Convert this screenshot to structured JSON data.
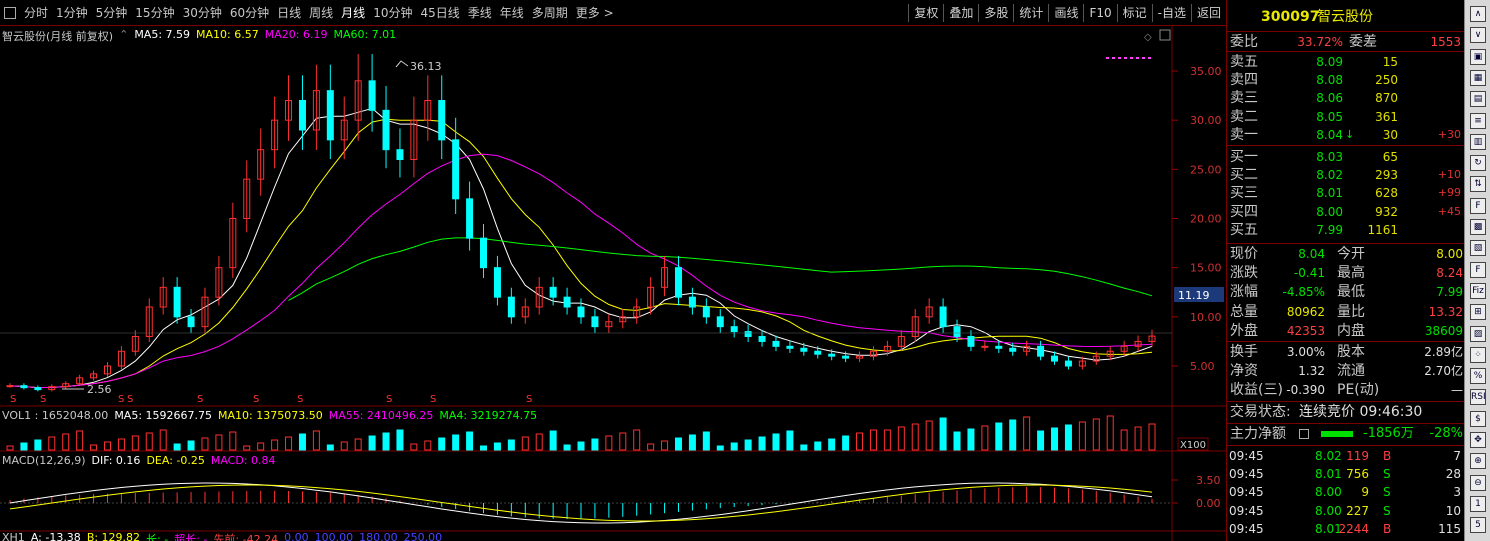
{
  "toolbar": {
    "periods": [
      "分时",
      "1分钟",
      "5分钟",
      "15分钟",
      "30分钟",
      "60分钟",
      "日线",
      "周线",
      "月线",
      "10分钟",
      "45日线",
      "季线",
      "年线",
      "多周期",
      "更多 >"
    ],
    "active_period": "月线",
    "tools": [
      "复权",
      "叠加",
      "多股",
      "统计",
      "画线",
      "F10",
      "标记",
      "-自选",
      "返回"
    ]
  },
  "main_legend": {
    "title": "智云股份(月线 前复权)",
    "ma5": "MA5: 7.59",
    "ma10": "MA10: 6.57",
    "ma20": "MA20: 6.19",
    "ma60": "MA60: 7.01",
    "high_label": "36.13",
    "low_label": "2.56",
    "last_price_tag": "11.19",
    "price_ticks": [
      "35.00",
      "30.00",
      "25.00",
      "20.00",
      "15.00",
      "10.00",
      "5.00"
    ],
    "marker_glyph": "S"
  },
  "vol_legend": {
    "vol": "VOL1 : 1652048.00",
    "ma5": "MA5: 1592667.75",
    "ma10": "MA10: 1375073.50",
    "ma55": "MA55: 2410496.25",
    "ma4": "MA4: 3219274.75",
    "unit": "X100"
  },
  "macd_legend": {
    "name": "MACD(12,26,9)",
    "dif": "DIF: 0.16",
    "dea": "DEA: -0.25",
    "macd": "MACD: 0.84",
    "ticks": [
      "3.50",
      "0.00"
    ]
  },
  "xh_legend": {
    "name": "XH1",
    "a": "A: -13.38",
    "b": "B: 129.82",
    "c": "长: -",
    "d": "超长: -",
    "e": "先前: -42.24",
    "f": "0.00",
    "g": "100.00",
    "h": "180.00",
    "i": "250.00"
  },
  "quote": {
    "code": "300097",
    "name": "智云股份",
    "weibi_label": "委比",
    "weibi": "33.72%",
    "weicha_label": "委差",
    "weicha": "1553",
    "asks": [
      {
        "label": "卖五",
        "price": "8.09",
        "vol": "15",
        "chg": ""
      },
      {
        "label": "卖四",
        "price": "8.08",
        "vol": "250",
        "chg": ""
      },
      {
        "label": "卖三",
        "price": "8.06",
        "vol": "870",
        "chg": ""
      },
      {
        "label": "卖二",
        "price": "8.05",
        "vol": "361",
        "chg": ""
      },
      {
        "label": "卖一",
        "price": "8.04",
        "vol": "30",
        "chg": "+30"
      }
    ],
    "bids": [
      {
        "label": "买一",
        "price": "8.03",
        "vol": "65",
        "chg": ""
      },
      {
        "label": "买二",
        "price": "8.02",
        "vol": "293",
        "chg": "+10"
      },
      {
        "label": "买三",
        "price": "8.01",
        "vol": "628",
        "chg": "+99"
      },
      {
        "label": "买四",
        "price": "8.00",
        "vol": "932",
        "chg": "+45"
      },
      {
        "label": "买五",
        "price": "7.99",
        "vol": "1161",
        "chg": ""
      }
    ],
    "stats": [
      {
        "l1": "现价",
        "v1": "8.04",
        "l2": "今开",
        "v2": "8.00"
      },
      {
        "l1": "涨跌",
        "v1": "-0.41",
        "l2": "最高",
        "v2": "8.24"
      },
      {
        "l1": "涨幅",
        "v1": "-4.85%",
        "l2": "最低",
        "v2": "7.99"
      },
      {
        "l1": "总量",
        "v1": "80962",
        "l2": "量比",
        "v2": "13.32"
      },
      {
        "l1": "外盘",
        "v1": "42353",
        "l2": "内盘",
        "v2": "38609"
      }
    ],
    "stats2": [
      {
        "l1": "换手",
        "v1": "3.00%",
        "l2": "股本",
        "v2": "2.89亿"
      },
      {
        "l1": "净资",
        "v1": "1.32",
        "l2": "流通",
        "v2": "2.70亿"
      },
      {
        "l1": "收益(三)",
        "v1": "-0.390",
        "l2": "PE(动)",
        "v2": "—"
      }
    ],
    "status_label": "交易状态:",
    "status": "连续竞价 09:46:30",
    "main_net_label": "主力净额",
    "main_net": "-1856万",
    "main_net_pct": "-28%",
    "ticks": [
      {
        "t": "09:45",
        "p": "8.02",
        "v": "119",
        "d": "B",
        "n": "7"
      },
      {
        "t": "09:45",
        "p": "8.01",
        "v": "756",
        "d": "S",
        "n": "28"
      },
      {
        "t": "09:45",
        "p": "8.00",
        "v": "9",
        "d": "S",
        "n": "3"
      },
      {
        "t": "09:45",
        "p": "8.00",
        "v": "227",
        "d": "S",
        "n": "10"
      },
      {
        "t": "09:45",
        "p": "8.01",
        "v": "2244",
        "d": "B",
        "n": "115"
      }
    ]
  },
  "side_icons": [
    "collapse-icon",
    "expand-icon",
    "down-icon",
    "grid-icon",
    "table-icon",
    "list-icon",
    "bar-chart-icon",
    "refresh-icon",
    "candle-icon",
    "fund-icon",
    "sector-icon",
    "news-icon",
    "ftab-icon",
    "fiz-icon",
    "hist-icon",
    "chart-icon",
    "scatter-icon",
    "pct-icon",
    "rsi-icon",
    "dollar-icon",
    "move-icon",
    "zoom-icon",
    "zoomout-icon",
    "num1-icon",
    "num5-icon"
  ],
  "side_icon_glyphs": [
    "∧",
    "∨",
    "▣",
    "▦",
    "▤",
    "≡",
    "▥",
    "↻",
    "⇅",
    "F",
    "▩",
    "▧",
    "F",
    "Fiz",
    "⊞",
    "▨",
    "⁘",
    "%",
    "RSI",
    "$",
    "✥",
    "⊕",
    "⊖",
    "1",
    "5"
  ],
  "colors": {
    "up": "#ff3030",
    "down": "#00ffff",
    "ma5": "#ffffff",
    "ma10": "#ffff00",
    "ma20": "#ff00ff",
    "ma60": "#00ff00",
    "grid": "#7a0000"
  }
}
